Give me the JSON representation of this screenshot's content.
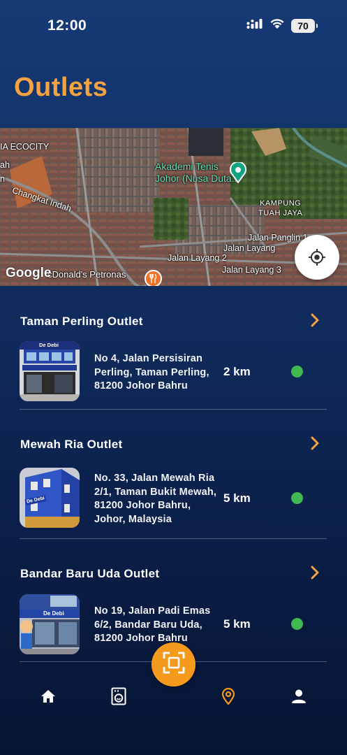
{
  "status_bar": {
    "time": "12:00",
    "battery": "70",
    "icons": [
      "cellular-signal-icon",
      "wifi-icon",
      "battery-icon"
    ]
  },
  "header": {
    "title": "Outlets"
  },
  "map": {
    "attribution": "Google",
    "labels": {
      "ecocity": "IA ECOCITY",
      "changkat": "Changkat Indah",
      "akademi": "Akademi Tenis\nJohor (Nusa Duta...",
      "kampung": "KAMPUNG\nTUAH JAYA",
      "panglin": "Jalan Panglin 1",
      "layang": "Jalan Layang",
      "layang2": "Jalan Layang 2",
      "layang3": "Jalan Layang 3",
      "petronas": "cDonald's Petronas",
      "ah": "ah",
      "n": "n"
    },
    "icons": [
      "map-pin-icon",
      "restaurant-icon",
      "my-location-icon"
    ]
  },
  "outlets": [
    {
      "name": "Taman Perling Outlet",
      "address": "No 4, Jalan Persisiran Perling, Taman Perling, 81200 Johor Bahru",
      "distance": "2 km",
      "status_color": "#3fb950",
      "thumb_sign": "De Debi"
    },
    {
      "name": "Mewah Ria Outlet",
      "address": "No. 33, Jalan Mewah Ria 2/1, Taman Bukit Mewah, 81200 Johor Bahru, Johor, Malaysia",
      "distance": "5 km",
      "status_color": "#3fb950",
      "thumb_sign": "De Debi"
    },
    {
      "name": "Bandar Baru Uda Outlet",
      "address": "No 19, Jalan Padi Emas 6/2, Bandar Baru Uda, 81200 Johor Bahru",
      "distance": "5 km",
      "status_color": "#3fb950",
      "thumb_sign": "De Debi"
    }
  ],
  "bottom_nav": {
    "items": [
      "home-icon",
      "washing-machine-icon",
      "scan-icon",
      "location-pin-icon",
      "profile-icon"
    ],
    "active": "location-pin-icon"
  },
  "colors": {
    "accent": "#f4a340",
    "fab": "#f59a1c",
    "background_top": "#163a76",
    "background_bottom": "#071533",
    "status_open": "#3fb950"
  }
}
